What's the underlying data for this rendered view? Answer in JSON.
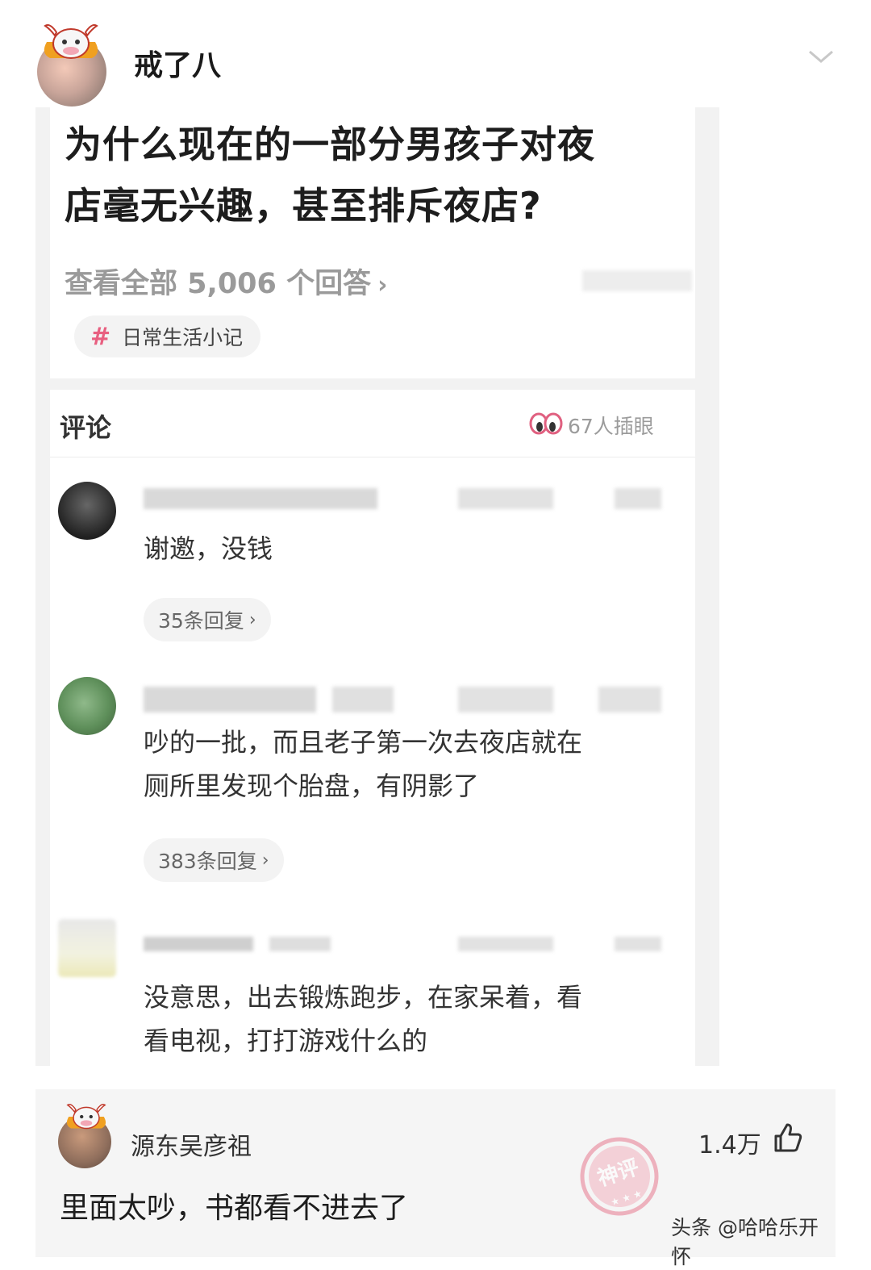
{
  "post": {
    "author": "戒了八"
  },
  "question": {
    "title_line1": "为什么现在的一部分男孩子对夜",
    "title_line2": "店毫无兴趣，甚至排斥夜店?",
    "answers_link": "查看全部 5,006 个回答",
    "tag": "日常生活小记"
  },
  "comments_section": {
    "title": "评论",
    "watchers": "67人插眼",
    "items": [
      {
        "lines": [
          "谢邀，没钱"
        ],
        "replies": "35条回复"
      },
      {
        "lines": [
          "吵的一批，而且老子第一次去夜店就在",
          "厕所里发现个胎盘，有阴影了"
        ],
        "replies": "383条回复"
      },
      {
        "lines": [
          "没意思，出去锻炼跑步，在家呆着，看",
          "看电视，打打游戏什么的"
        ]
      }
    ]
  },
  "top_comment": {
    "author": "源东吴彦祖",
    "likes": "1.4万",
    "text": "里面太吵，书都看不进去了",
    "stamp": "神评"
  },
  "watermark": "头条 @哈哈乐开怀",
  "colors": {
    "tag_hash": "#e85f80",
    "stamp": "#e87a90",
    "muted_text": "#9a9a9a"
  }
}
